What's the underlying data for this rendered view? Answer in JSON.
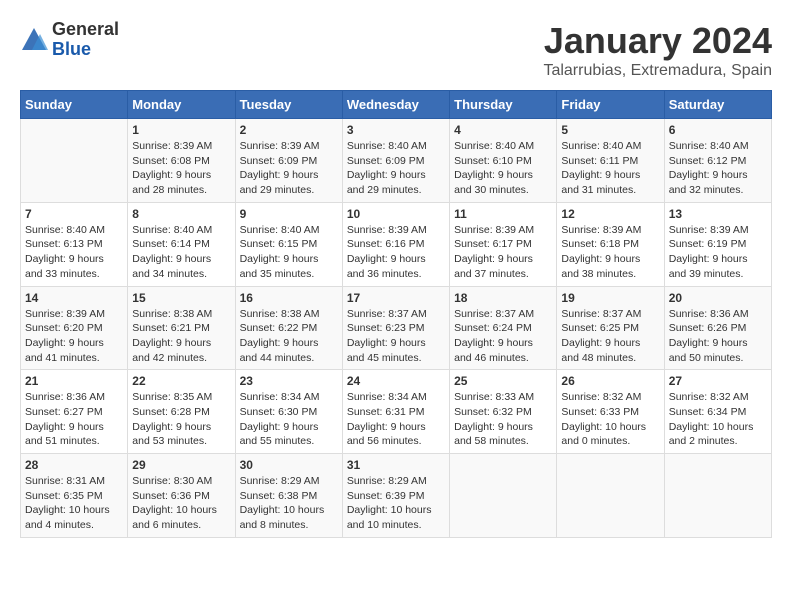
{
  "header": {
    "logo_general": "General",
    "logo_blue": "Blue",
    "title": "January 2024",
    "subtitle": "Talarrubias, Extremadura, Spain"
  },
  "columns": [
    "Sunday",
    "Monday",
    "Tuesday",
    "Wednesday",
    "Thursday",
    "Friday",
    "Saturday"
  ],
  "weeks": [
    [
      {
        "day": "",
        "sunrise": "",
        "sunset": "",
        "daylight": ""
      },
      {
        "day": "1",
        "sunrise": "Sunrise: 8:39 AM",
        "sunset": "Sunset: 6:08 PM",
        "daylight": "Daylight: 9 hours and 28 minutes."
      },
      {
        "day": "2",
        "sunrise": "Sunrise: 8:39 AM",
        "sunset": "Sunset: 6:09 PM",
        "daylight": "Daylight: 9 hours and 29 minutes."
      },
      {
        "day": "3",
        "sunrise": "Sunrise: 8:40 AM",
        "sunset": "Sunset: 6:09 PM",
        "daylight": "Daylight: 9 hours and 29 minutes."
      },
      {
        "day": "4",
        "sunrise": "Sunrise: 8:40 AM",
        "sunset": "Sunset: 6:10 PM",
        "daylight": "Daylight: 9 hours and 30 minutes."
      },
      {
        "day": "5",
        "sunrise": "Sunrise: 8:40 AM",
        "sunset": "Sunset: 6:11 PM",
        "daylight": "Daylight: 9 hours and 31 minutes."
      },
      {
        "day": "6",
        "sunrise": "Sunrise: 8:40 AM",
        "sunset": "Sunset: 6:12 PM",
        "daylight": "Daylight: 9 hours and 32 minutes."
      }
    ],
    [
      {
        "day": "7",
        "sunrise": "Sunrise: 8:40 AM",
        "sunset": "Sunset: 6:13 PM",
        "daylight": "Daylight: 9 hours and 33 minutes."
      },
      {
        "day": "8",
        "sunrise": "Sunrise: 8:40 AM",
        "sunset": "Sunset: 6:14 PM",
        "daylight": "Daylight: 9 hours and 34 minutes."
      },
      {
        "day": "9",
        "sunrise": "Sunrise: 8:40 AM",
        "sunset": "Sunset: 6:15 PM",
        "daylight": "Daylight: 9 hours and 35 minutes."
      },
      {
        "day": "10",
        "sunrise": "Sunrise: 8:39 AM",
        "sunset": "Sunset: 6:16 PM",
        "daylight": "Daylight: 9 hours and 36 minutes."
      },
      {
        "day": "11",
        "sunrise": "Sunrise: 8:39 AM",
        "sunset": "Sunset: 6:17 PM",
        "daylight": "Daylight: 9 hours and 37 minutes."
      },
      {
        "day": "12",
        "sunrise": "Sunrise: 8:39 AM",
        "sunset": "Sunset: 6:18 PM",
        "daylight": "Daylight: 9 hours and 38 minutes."
      },
      {
        "day": "13",
        "sunrise": "Sunrise: 8:39 AM",
        "sunset": "Sunset: 6:19 PM",
        "daylight": "Daylight: 9 hours and 39 minutes."
      }
    ],
    [
      {
        "day": "14",
        "sunrise": "Sunrise: 8:39 AM",
        "sunset": "Sunset: 6:20 PM",
        "daylight": "Daylight: 9 hours and 41 minutes."
      },
      {
        "day": "15",
        "sunrise": "Sunrise: 8:38 AM",
        "sunset": "Sunset: 6:21 PM",
        "daylight": "Daylight: 9 hours and 42 minutes."
      },
      {
        "day": "16",
        "sunrise": "Sunrise: 8:38 AM",
        "sunset": "Sunset: 6:22 PM",
        "daylight": "Daylight: 9 hours and 44 minutes."
      },
      {
        "day": "17",
        "sunrise": "Sunrise: 8:37 AM",
        "sunset": "Sunset: 6:23 PM",
        "daylight": "Daylight: 9 hours and 45 minutes."
      },
      {
        "day": "18",
        "sunrise": "Sunrise: 8:37 AM",
        "sunset": "Sunset: 6:24 PM",
        "daylight": "Daylight: 9 hours and 46 minutes."
      },
      {
        "day": "19",
        "sunrise": "Sunrise: 8:37 AM",
        "sunset": "Sunset: 6:25 PM",
        "daylight": "Daylight: 9 hours and 48 minutes."
      },
      {
        "day": "20",
        "sunrise": "Sunrise: 8:36 AM",
        "sunset": "Sunset: 6:26 PM",
        "daylight": "Daylight: 9 hours and 50 minutes."
      }
    ],
    [
      {
        "day": "21",
        "sunrise": "Sunrise: 8:36 AM",
        "sunset": "Sunset: 6:27 PM",
        "daylight": "Daylight: 9 hours and 51 minutes."
      },
      {
        "day": "22",
        "sunrise": "Sunrise: 8:35 AM",
        "sunset": "Sunset: 6:28 PM",
        "daylight": "Daylight: 9 hours and 53 minutes."
      },
      {
        "day": "23",
        "sunrise": "Sunrise: 8:34 AM",
        "sunset": "Sunset: 6:30 PM",
        "daylight": "Daylight: 9 hours and 55 minutes."
      },
      {
        "day": "24",
        "sunrise": "Sunrise: 8:34 AM",
        "sunset": "Sunset: 6:31 PM",
        "daylight": "Daylight: 9 hours and 56 minutes."
      },
      {
        "day": "25",
        "sunrise": "Sunrise: 8:33 AM",
        "sunset": "Sunset: 6:32 PM",
        "daylight": "Daylight: 9 hours and 58 minutes."
      },
      {
        "day": "26",
        "sunrise": "Sunrise: 8:32 AM",
        "sunset": "Sunset: 6:33 PM",
        "daylight": "Daylight: 10 hours and 0 minutes."
      },
      {
        "day": "27",
        "sunrise": "Sunrise: 8:32 AM",
        "sunset": "Sunset: 6:34 PM",
        "daylight": "Daylight: 10 hours and 2 minutes."
      }
    ],
    [
      {
        "day": "28",
        "sunrise": "Sunrise: 8:31 AM",
        "sunset": "Sunset: 6:35 PM",
        "daylight": "Daylight: 10 hours and 4 minutes."
      },
      {
        "day": "29",
        "sunrise": "Sunrise: 8:30 AM",
        "sunset": "Sunset: 6:36 PM",
        "daylight": "Daylight: 10 hours and 6 minutes."
      },
      {
        "day": "30",
        "sunrise": "Sunrise: 8:29 AM",
        "sunset": "Sunset: 6:38 PM",
        "daylight": "Daylight: 10 hours and 8 minutes."
      },
      {
        "day": "31",
        "sunrise": "Sunrise: 8:29 AM",
        "sunset": "Sunset: 6:39 PM",
        "daylight": "Daylight: 10 hours and 10 minutes."
      },
      {
        "day": "",
        "sunrise": "",
        "sunset": "",
        "daylight": ""
      },
      {
        "day": "",
        "sunrise": "",
        "sunset": "",
        "daylight": ""
      },
      {
        "day": "",
        "sunrise": "",
        "sunset": "",
        "daylight": ""
      }
    ]
  ]
}
